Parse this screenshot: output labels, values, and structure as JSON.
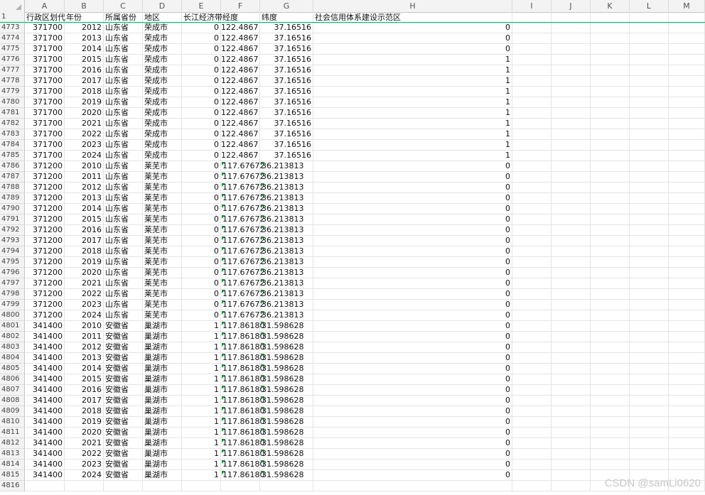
{
  "columns": [
    "A",
    "B",
    "C",
    "D",
    "E",
    "F",
    "G",
    "H",
    "I",
    "J",
    "K",
    "L",
    "M"
  ],
  "header_row": {
    "num": "1",
    "cells": [
      "行政区划代",
      "年份",
      "所属省份",
      "地区",
      "长江经济带",
      "经度",
      "纬度",
      "社会信用体系建设示范区"
    ]
  },
  "rows": [
    {
      "num": "4773",
      "code": "371700",
      "year": "2012",
      "prov": "山东省",
      "city": "荣成市",
      "yz": "0",
      "lon": "122.4867",
      "lat": "37.16516",
      "demo": "0"
    },
    {
      "num": "4774",
      "code": "371700",
      "year": "2013",
      "prov": "山东省",
      "city": "荣成市",
      "yz": "0",
      "lon": "122.4867",
      "lat": "37.16516",
      "demo": "0"
    },
    {
      "num": "4775",
      "code": "371700",
      "year": "2014",
      "prov": "山东省",
      "city": "荣成市",
      "yz": "0",
      "lon": "122.4867",
      "lat": "37.16516",
      "demo": "0"
    },
    {
      "num": "4776",
      "code": "371700",
      "year": "2015",
      "prov": "山东省",
      "city": "荣成市",
      "yz": "0",
      "lon": "122.4867",
      "lat": "37.16516",
      "demo": "1"
    },
    {
      "num": "4777",
      "code": "371700",
      "year": "2016",
      "prov": "山东省",
      "city": "荣成市",
      "yz": "0",
      "lon": "122.4867",
      "lat": "37.16516",
      "demo": "1"
    },
    {
      "num": "4778",
      "code": "371700",
      "year": "2017",
      "prov": "山东省",
      "city": "荣成市",
      "yz": "0",
      "lon": "122.4867",
      "lat": "37.16516",
      "demo": "1"
    },
    {
      "num": "4779",
      "code": "371700",
      "year": "2018",
      "prov": "山东省",
      "city": "荣成市",
      "yz": "0",
      "lon": "122.4867",
      "lat": "37.16516",
      "demo": "1"
    },
    {
      "num": "4780",
      "code": "371700",
      "year": "2019",
      "prov": "山东省",
      "city": "荣成市",
      "yz": "0",
      "lon": "122.4867",
      "lat": "37.16516",
      "demo": "1"
    },
    {
      "num": "4781",
      "code": "371700",
      "year": "2020",
      "prov": "山东省",
      "city": "荣成市",
      "yz": "0",
      "lon": "122.4867",
      "lat": "37.16516",
      "demo": "1"
    },
    {
      "num": "4782",
      "code": "371700",
      "year": "2021",
      "prov": "山东省",
      "city": "荣成市",
      "yz": "0",
      "lon": "122.4867",
      "lat": "37.16516",
      "demo": "1"
    },
    {
      "num": "4783",
      "code": "371700",
      "year": "2022",
      "prov": "山东省",
      "city": "荣成市",
      "yz": "0",
      "lon": "122.4867",
      "lat": "37.16516",
      "demo": "1"
    },
    {
      "num": "4784",
      "code": "371700",
      "year": "2023",
      "prov": "山东省",
      "city": "荣成市",
      "yz": "0",
      "lon": "122.4867",
      "lat": "37.16516",
      "demo": "1"
    },
    {
      "num": "4785",
      "code": "371700",
      "year": "2024",
      "prov": "山东省",
      "city": "荣成市",
      "yz": "0",
      "lon": "122.4867",
      "lat": "37.16516",
      "demo": "1"
    },
    {
      "num": "4786",
      "code": "371200",
      "year": "2010",
      "prov": "山东省",
      "city": "莱芜市",
      "yz": "0",
      "lon": "117.67672",
      "lat": "36.213813",
      "demo": "0"
    },
    {
      "num": "4787",
      "code": "371200",
      "year": "2011",
      "prov": "山东省",
      "city": "莱芜市",
      "yz": "0",
      "lon": "117.67672",
      "lat": "36.213813",
      "demo": "0"
    },
    {
      "num": "4788",
      "code": "371200",
      "year": "2012",
      "prov": "山东省",
      "city": "莱芜市",
      "yz": "0",
      "lon": "117.67672",
      "lat": "36.213813",
      "demo": "0"
    },
    {
      "num": "4789",
      "code": "371200",
      "year": "2013",
      "prov": "山东省",
      "city": "莱芜市",
      "yz": "0",
      "lon": "117.67672",
      "lat": "36.213813",
      "demo": "0"
    },
    {
      "num": "4790",
      "code": "371200",
      "year": "2014",
      "prov": "山东省",
      "city": "莱芜市",
      "yz": "0",
      "lon": "117.67672",
      "lat": "36.213813",
      "demo": "0"
    },
    {
      "num": "4791",
      "code": "371200",
      "year": "2015",
      "prov": "山东省",
      "city": "莱芜市",
      "yz": "0",
      "lon": "117.67672",
      "lat": "36.213813",
      "demo": "0"
    },
    {
      "num": "4792",
      "code": "371200",
      "year": "2016",
      "prov": "山东省",
      "city": "莱芜市",
      "yz": "0",
      "lon": "117.67672",
      "lat": "36.213813",
      "demo": "0"
    },
    {
      "num": "4793",
      "code": "371200",
      "year": "2017",
      "prov": "山东省",
      "city": "莱芜市",
      "yz": "0",
      "lon": "117.67672",
      "lat": "36.213813",
      "demo": "0"
    },
    {
      "num": "4794",
      "code": "371200",
      "year": "2018",
      "prov": "山东省",
      "city": "莱芜市",
      "yz": "0",
      "lon": "117.67672",
      "lat": "36.213813",
      "demo": "0"
    },
    {
      "num": "4795",
      "code": "371200",
      "year": "2019",
      "prov": "山东省",
      "city": "莱芜市",
      "yz": "0",
      "lon": "117.67672",
      "lat": "36.213813",
      "demo": "0"
    },
    {
      "num": "4796",
      "code": "371200",
      "year": "2020",
      "prov": "山东省",
      "city": "莱芜市",
      "yz": "0",
      "lon": "117.67672",
      "lat": "36.213813",
      "demo": "0"
    },
    {
      "num": "4797",
      "code": "371200",
      "year": "2021",
      "prov": "山东省",
      "city": "莱芜市",
      "yz": "0",
      "lon": "117.67672",
      "lat": "36.213813",
      "demo": "0"
    },
    {
      "num": "4798",
      "code": "371200",
      "year": "2022",
      "prov": "山东省",
      "city": "莱芜市",
      "yz": "0",
      "lon": "117.67672",
      "lat": "36.213813",
      "demo": "0"
    },
    {
      "num": "4799",
      "code": "371200",
      "year": "2023",
      "prov": "山东省",
      "city": "莱芜市",
      "yz": "0",
      "lon": "117.67672",
      "lat": "36.213813",
      "demo": "0"
    },
    {
      "num": "4800",
      "code": "371200",
      "year": "2024",
      "prov": "山东省",
      "city": "莱芜市",
      "yz": "0",
      "lon": "117.67672",
      "lat": "36.213813",
      "demo": "0"
    },
    {
      "num": "4801",
      "code": "341400",
      "year": "2010",
      "prov": "安徽省",
      "city": "巢湖市",
      "yz": "1",
      "lon": "117.86180",
      "lat": "31.598628",
      "demo": "0"
    },
    {
      "num": "4802",
      "code": "341400",
      "year": "2011",
      "prov": "安徽省",
      "city": "巢湖市",
      "yz": "1",
      "lon": "117.86180",
      "lat": "31.598628",
      "demo": "0"
    },
    {
      "num": "4803",
      "code": "341400",
      "year": "2012",
      "prov": "安徽省",
      "city": "巢湖市",
      "yz": "1",
      "lon": "117.86180",
      "lat": "31.598628",
      "demo": "0"
    },
    {
      "num": "4804",
      "code": "341400",
      "year": "2013",
      "prov": "安徽省",
      "city": "巢湖市",
      "yz": "1",
      "lon": "117.86180",
      "lat": "31.598628",
      "demo": "0"
    },
    {
      "num": "4805",
      "code": "341400",
      "year": "2014",
      "prov": "安徽省",
      "city": "巢湖市",
      "yz": "1",
      "lon": "117.86180",
      "lat": "31.598628",
      "demo": "0"
    },
    {
      "num": "4806",
      "code": "341400",
      "year": "2015",
      "prov": "安徽省",
      "city": "巢湖市",
      "yz": "1",
      "lon": "117.86180",
      "lat": "31.598628",
      "demo": "0"
    },
    {
      "num": "4807",
      "code": "341400",
      "year": "2016",
      "prov": "安徽省",
      "city": "巢湖市",
      "yz": "1",
      "lon": "117.86180",
      "lat": "31.598628",
      "demo": "0"
    },
    {
      "num": "4808",
      "code": "341400",
      "year": "2017",
      "prov": "安徽省",
      "city": "巢湖市",
      "yz": "1",
      "lon": "117.86180",
      "lat": "31.598628",
      "demo": "0"
    },
    {
      "num": "4809",
      "code": "341400",
      "year": "2018",
      "prov": "安徽省",
      "city": "巢湖市",
      "yz": "1",
      "lon": "117.86180",
      "lat": "31.598628",
      "demo": "0"
    },
    {
      "num": "4810",
      "code": "341400",
      "year": "2019",
      "prov": "安徽省",
      "city": "巢湖市",
      "yz": "1",
      "lon": "117.86180",
      "lat": "31.598628",
      "demo": "0"
    },
    {
      "num": "4811",
      "code": "341400",
      "year": "2020",
      "prov": "安徽省",
      "city": "巢湖市",
      "yz": "1",
      "lon": "117.86180",
      "lat": "31.598628",
      "demo": "0"
    },
    {
      "num": "4812",
      "code": "341400",
      "year": "2021",
      "prov": "安徽省",
      "city": "巢湖市",
      "yz": "1",
      "lon": "117.86180",
      "lat": "31.598628",
      "demo": "0"
    },
    {
      "num": "4813",
      "code": "341400",
      "year": "2022",
      "prov": "安徽省",
      "city": "巢湖市",
      "yz": "1",
      "lon": "117.86180",
      "lat": "31.598628",
      "demo": "0"
    },
    {
      "num": "4814",
      "code": "341400",
      "year": "2023",
      "prov": "安徽省",
      "city": "巢湖市",
      "yz": "1",
      "lon": "117.86180",
      "lat": "31.598628",
      "demo": "0"
    },
    {
      "num": "4815",
      "code": "341400",
      "year": "2024",
      "prov": "安徽省",
      "city": "巢湖市",
      "yz": "1",
      "lon": "117.86180",
      "lat": "31.598628",
      "demo": "0"
    },
    {
      "num": "4816",
      "code": "",
      "year": "",
      "prov": "",
      "city": "",
      "yz": "",
      "lon": "",
      "lat": "",
      "demo": ""
    }
  ],
  "watermark": "CSDN @samLi0620",
  "colors": {
    "freeze_line": "#2e9a57",
    "text_number_marker": "#1f8a3a",
    "header_bg": "#f3f3f3"
  }
}
